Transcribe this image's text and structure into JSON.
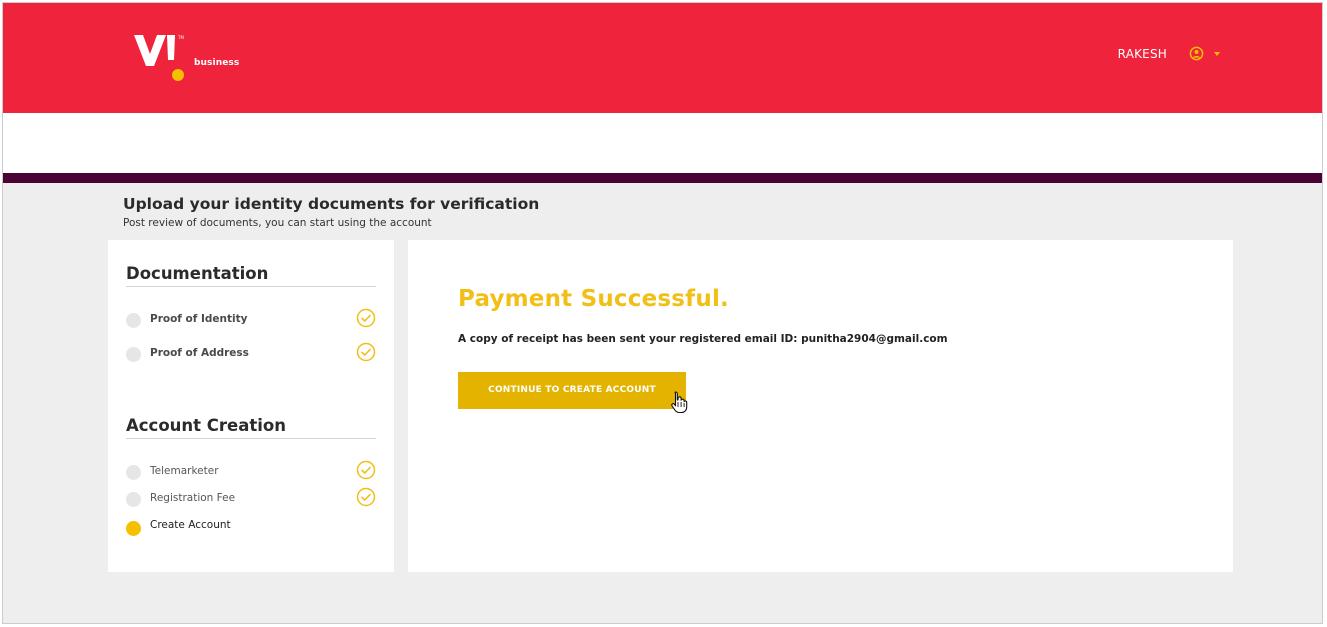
{
  "brand": {
    "logo_text": "Vi",
    "logo_sub": "business"
  },
  "header": {
    "username": "RAKESH",
    "user_icon": "user-circle-icon",
    "menu_icon": "caret-down-icon"
  },
  "page": {
    "title": "Upload your identity documents for verification",
    "subtitle": "Post review of documents, you can start using the account"
  },
  "sidebar": {
    "documentation": {
      "title": "Documentation",
      "steps": [
        {
          "label": "Proof of Identity",
          "completed": true
        },
        {
          "label": "Proof of Address",
          "completed": true
        }
      ]
    },
    "account_creation": {
      "title": "Account Creation",
      "steps": [
        {
          "label": "Telemarketer",
          "completed": true
        },
        {
          "label": "Registration Fee",
          "completed": true
        },
        {
          "label": "Create Account",
          "completed": false,
          "active": true
        }
      ]
    }
  },
  "main": {
    "title": "Payment Successful.",
    "receipt_text": "A copy of receipt has been sent your registered email ID: punitha2904@gmail.com",
    "cta_label": "CONTINUE TO CREATE ACCOUNT"
  },
  "colors": {
    "header_red": "#ef233c",
    "accent_yellow": "#f2bf17",
    "button_yellow": "#e3b300",
    "divider_purple": "#4b0235"
  }
}
